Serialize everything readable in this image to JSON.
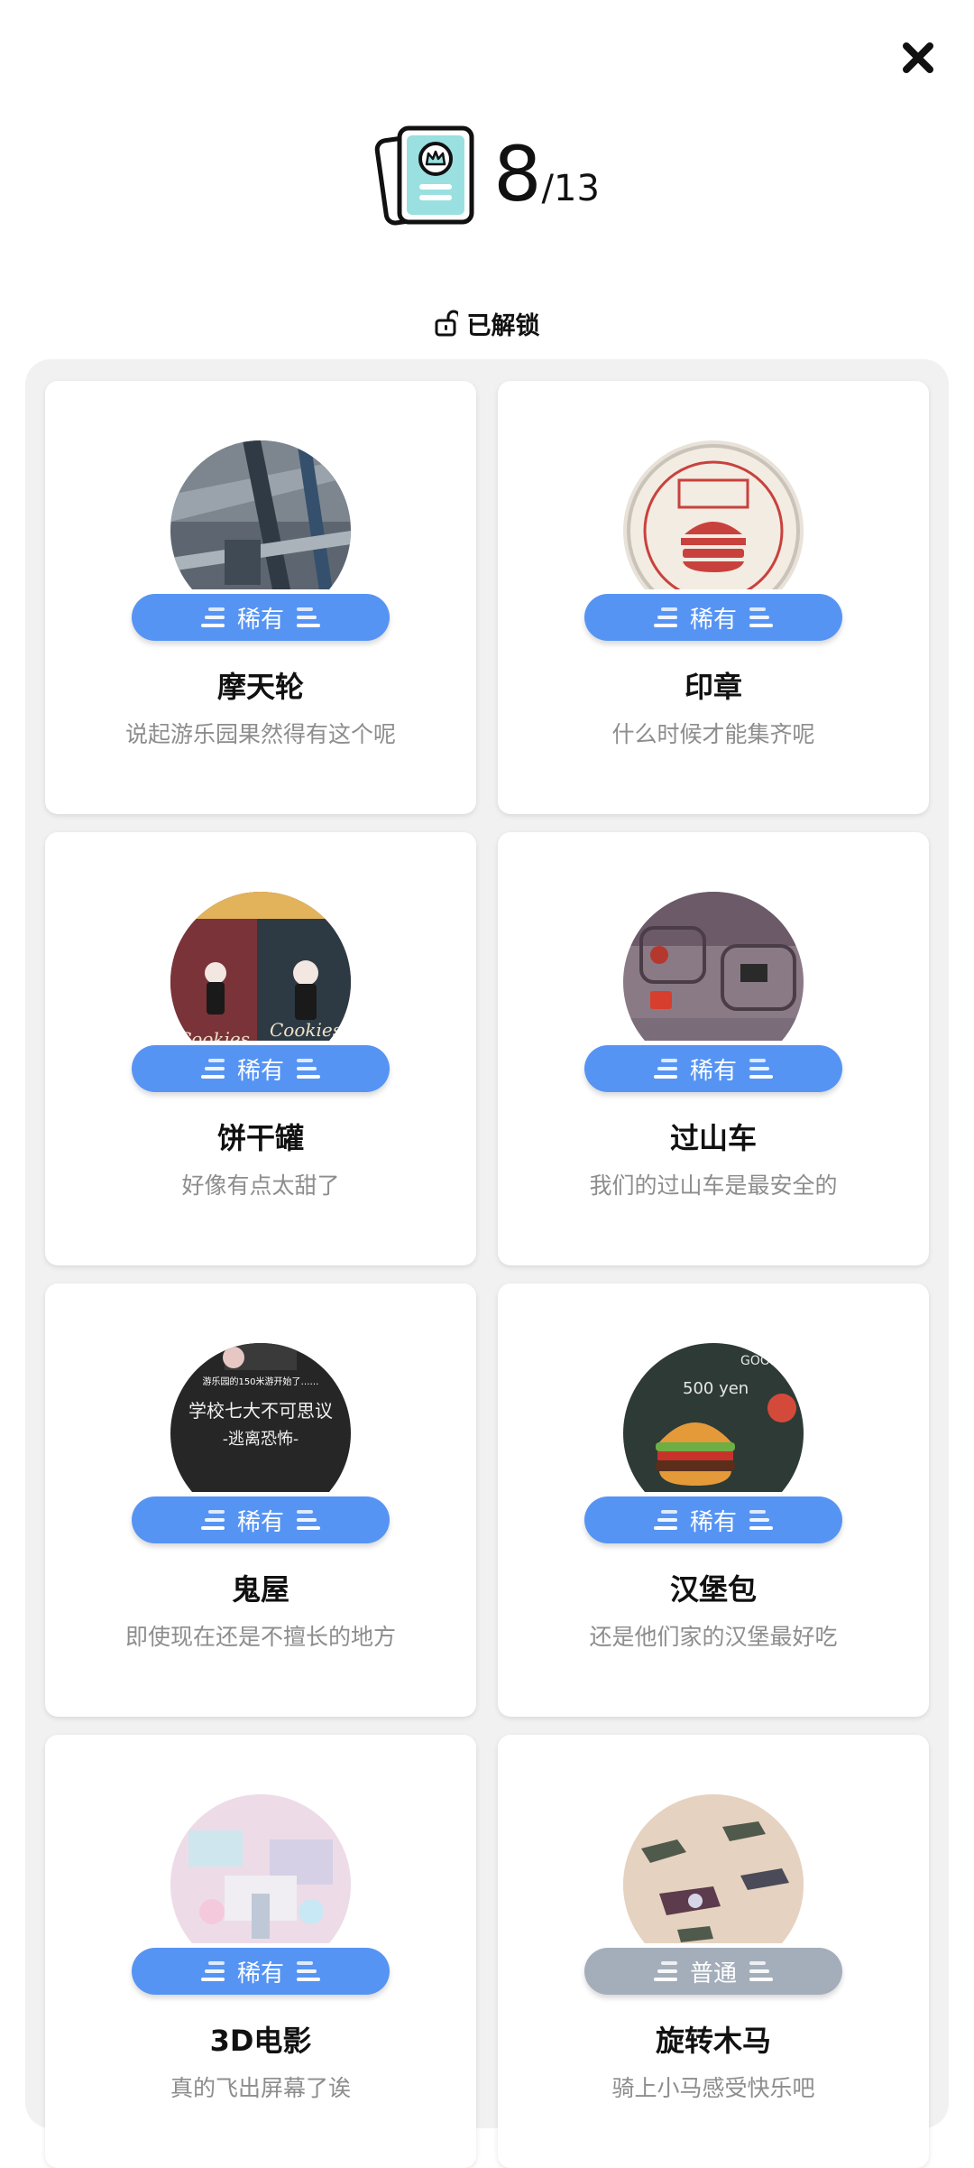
{
  "header": {
    "close_icon": "close-icon",
    "collection_icon": "card-collection-icon",
    "count_current": "8",
    "count_total": "/13"
  },
  "section": {
    "unlocked_label": "已解锁",
    "icon": "unlock-icon"
  },
  "rarity_colors": {
    "rare": "#5694f4",
    "common": "#a4aebb"
  },
  "cards": [
    {
      "title": "摩天轮",
      "desc": "说起游乐园果然得有这个呢",
      "rarity": "稀有"
    },
    {
      "title": "印章",
      "desc": "什么时候才能集齐呢",
      "rarity": "稀有"
    },
    {
      "title": "饼干罐",
      "desc": "好像有点太甜了",
      "rarity": "稀有"
    },
    {
      "title": "过山车",
      "desc": "我们的过山车是最安全的",
      "rarity": "稀有"
    },
    {
      "title": "鬼屋",
      "desc": "即使现在还是不擅长的地方",
      "rarity": "稀有"
    },
    {
      "title": "汉堡包",
      "desc": "还是他们家的汉堡最好吃",
      "rarity": "稀有"
    },
    {
      "title": "3D电影",
      "desc": "真的飞出屏幕了诶",
      "rarity": "稀有"
    },
    {
      "title": "旋转木马",
      "desc": "骑上小马感受快乐吧",
      "rarity": "普通"
    }
  ],
  "image_text": {
    "cookies_left": "Cookies",
    "cookies_right": "Cookies",
    "haunted_line1": "学校七大不可思议",
    "haunted_line2": "-逃离恐怖-",
    "haunted_top": "游乐园的150米游开始了……",
    "burger_goods": "GOODS",
    "burger_price": "500 yen"
  }
}
